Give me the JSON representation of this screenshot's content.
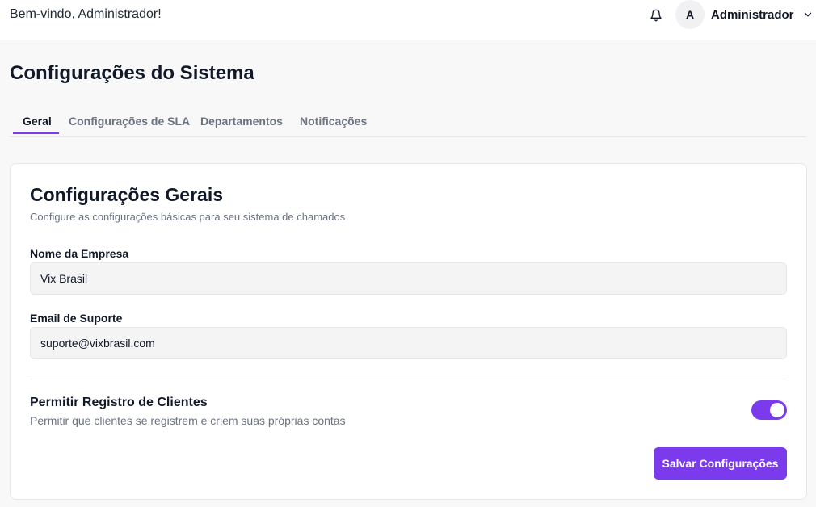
{
  "header": {
    "welcome_text": "Bem-vindo, Administrador!",
    "user": {
      "avatar_initial": "A",
      "name": "Administrador"
    },
    "icons": {
      "notifications": "bell-icon",
      "menu": "chevron-down-icon"
    }
  },
  "page": {
    "title": "Configurações do Sistema"
  },
  "tabs": [
    {
      "label": "Geral",
      "active": true
    },
    {
      "label": "Configurações de SLA",
      "active": false
    },
    {
      "label": "Departamentos",
      "active": false
    },
    {
      "label": "Notificações",
      "active": false
    }
  ],
  "card": {
    "title": "Configurações Gerais",
    "subtitle": "Configure as configurações básicas para seu sistema de chamados",
    "company_name": {
      "label": "Nome da Empresa",
      "value": "Vix Brasil"
    },
    "support_email": {
      "label": "Email de Suporte",
      "value": "suporte@vixbrasil.com"
    },
    "client_registration": {
      "title": "Permitir Registro de Clientes",
      "description": "Permitir que clientes se registrem e criem suas próprias contas",
      "enabled": true
    },
    "save_label": "Salvar Configurações"
  },
  "colors": {
    "accent": "#7c3aed",
    "background": "#f8f8f9",
    "card": "#ffffff",
    "input_bg": "#f4f4f5",
    "muted_text": "#6b7280"
  }
}
